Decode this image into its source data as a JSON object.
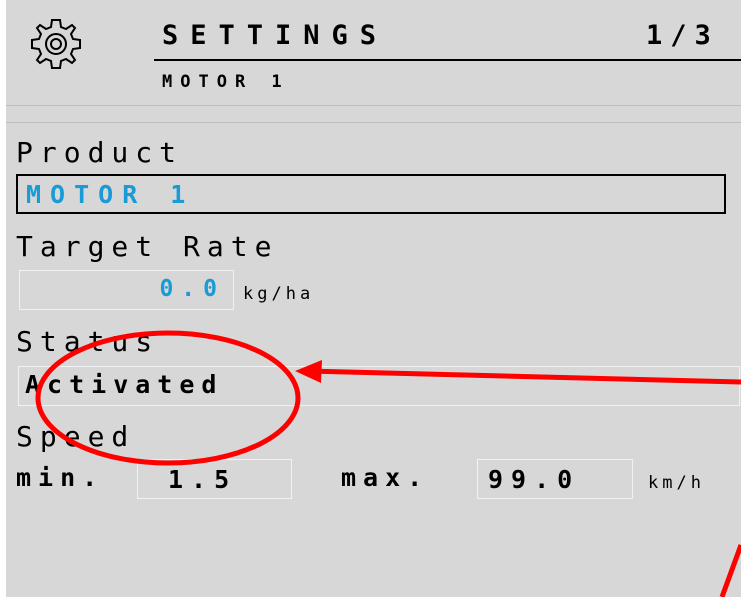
{
  "header": {
    "title": "SETTINGS",
    "page_counter": "1/3",
    "subtitle": "MOTOR 1"
  },
  "form": {
    "product_label": "Product",
    "product_value": "MOTOR 1",
    "target_rate_label": "Target Rate",
    "target_rate_value": "0.0",
    "target_rate_unit": "kg/ha",
    "status_label": "Status",
    "status_value": "Activated",
    "speed_label": "Speed",
    "speed_min_label": "min.",
    "speed_min_value": "1.5",
    "speed_max_label": "max.",
    "speed_max_value": "99.0",
    "speed_unit": "km/h"
  },
  "colors": {
    "screen_bg": "#d7d7d7",
    "value_blue": "#1a9bd6",
    "annotation_red": "#ff0000"
  },
  "icons": {
    "settings": "gear-icon"
  }
}
